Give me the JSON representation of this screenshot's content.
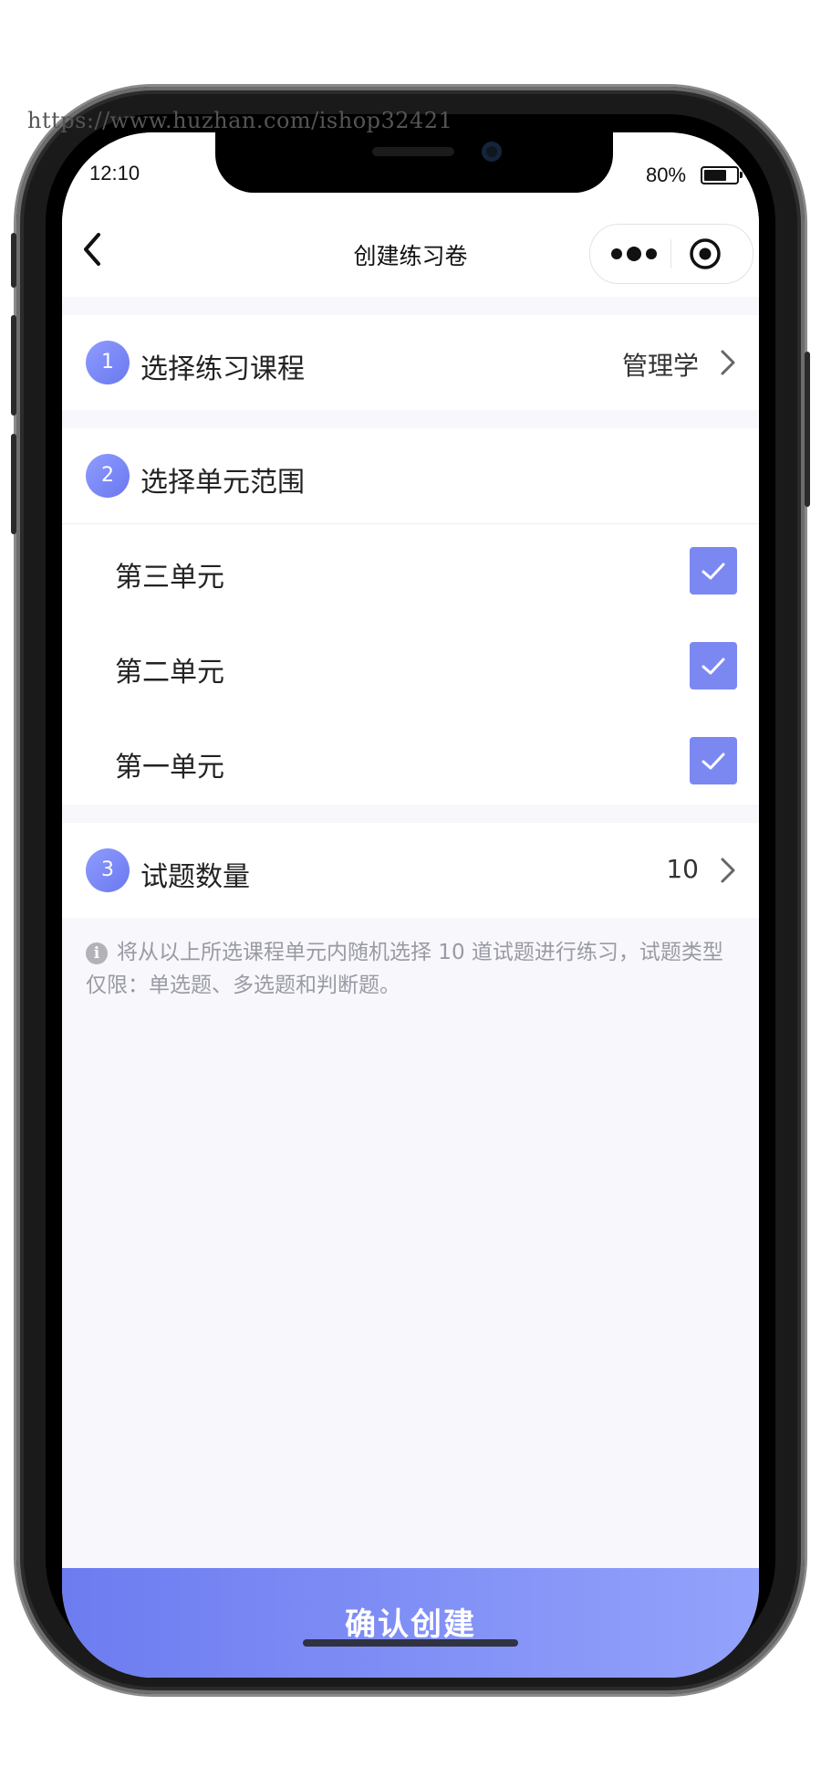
{
  "watermark": "https://www.huzhan.com/ishop32421",
  "status_bar": {
    "time": "12:10",
    "battery": "80%",
    "battery_level": 0.8
  },
  "nav": {
    "title": "创建练习卷",
    "back_icon": "chevron-left-icon",
    "more_icon": "more-dots-icon",
    "close_icon": "target-circle-icon"
  },
  "steps": {
    "course": {
      "number": "1",
      "title": "选择练习课程",
      "value": "管理学"
    },
    "units": {
      "number": "2",
      "title": "选择单元范围",
      "items": [
        {
          "label": "第三单元",
          "checked": true
        },
        {
          "label": "第二单元",
          "checked": true
        },
        {
          "label": "第一单元",
          "checked": true
        }
      ]
    },
    "count": {
      "number": "3",
      "title": "试题数量",
      "value": "10"
    }
  },
  "info": {
    "icon": "info-icon",
    "text": "将从以上所选课程单元内随机选择 10 道试题进行练习，试题类型仅限：单选题、多选题和判断题。"
  },
  "confirm_button": "确认创建",
  "colors": {
    "accent": "#7c88f2",
    "accent_gradient_start": "#6d7cf0",
    "accent_gradient_end": "#93a2fb",
    "page_bg": "#f7f7fc"
  }
}
